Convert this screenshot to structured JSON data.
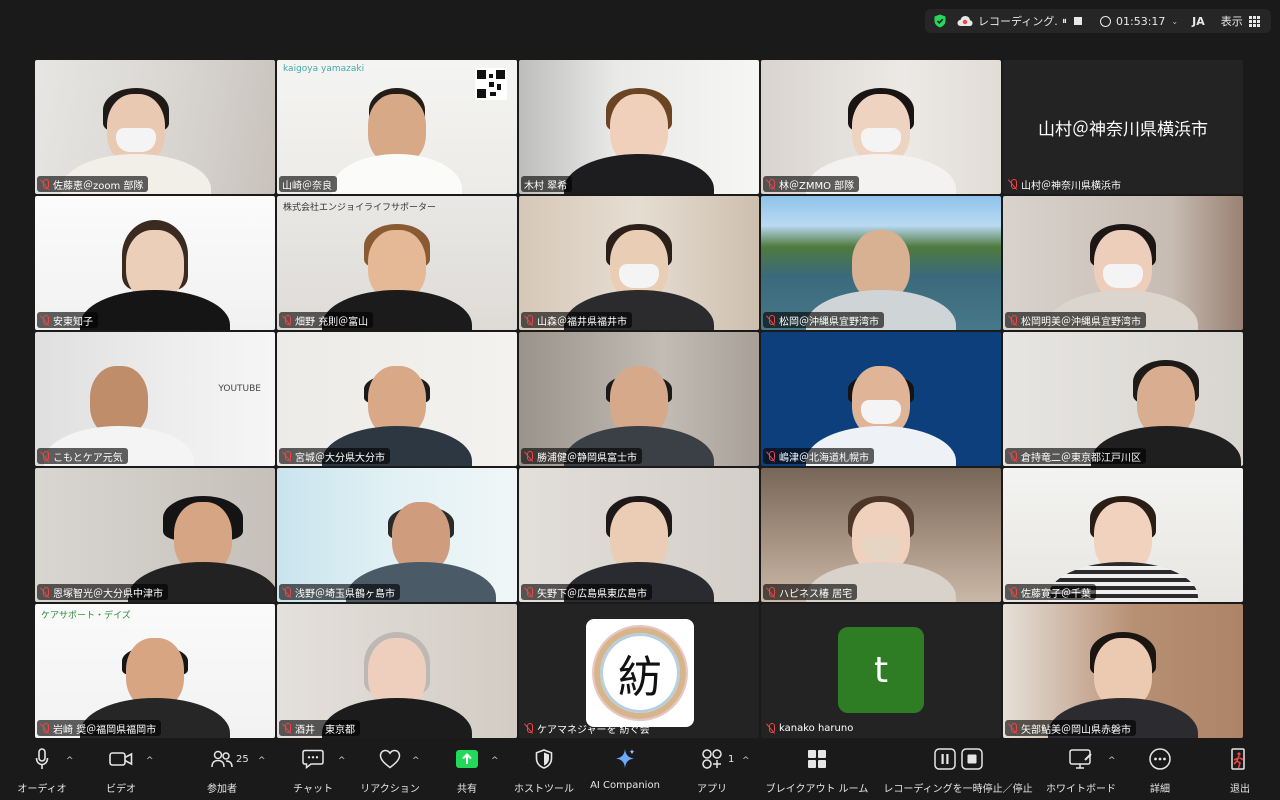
{
  "status_bar": {
    "recording_label": "レコーディング...",
    "pause_symbol": "⏸",
    "timer": "01:53:17",
    "chevron": "⌄",
    "language": "JA",
    "view_label": "表示"
  },
  "participants": [
    {
      "name": "佐藤恵＠zoom 部隊"
    },
    {
      "name": "山崎＠奈良",
      "banner": "kaigoya yamazaki"
    },
    {
      "name": "木村 翠希"
    },
    {
      "name": "林＠ZMMO 部隊"
    },
    {
      "name": "山村＠神奈川県横浜市",
      "display_text": "山村＠神奈川県横浜市"
    },
    {
      "name": "安東知子"
    },
    {
      "name": "畑野 充則＠富山",
      "banner": "株式会社エンジョイライフサポーター"
    },
    {
      "name": "山森＠福井県福井市"
    },
    {
      "name": "松岡＠沖縄県宜野湾市"
    },
    {
      "name": "松岡明美＠沖縄県宜野湾市"
    },
    {
      "name": "こもとケア元気",
      "banner": "YOUTUBE"
    },
    {
      "name": "宮城＠大分県大分市"
    },
    {
      "name": "勝浦健＠静岡県富士市"
    },
    {
      "name": "嶋津＠北海道札幌市"
    },
    {
      "name": "倉持竜二＠東京都江戸川区"
    },
    {
      "name": "恩塚智光＠大分県中津市"
    },
    {
      "name": "浅野＠埼玉県鶴ヶ島市"
    },
    {
      "name": "矢野下＠広島県東広島市"
    },
    {
      "name": "ハピネス椿 居宅"
    },
    {
      "name": "佐藤寛子＠千葉"
    },
    {
      "name": "岩崎 奨＠福岡県福岡市",
      "banner": "ケアサポート・デイズ"
    },
    {
      "name": "酒井　東京都"
    },
    {
      "name": "ケアマネジャーを 紡ぐ会",
      "logo_char": "紡"
    },
    {
      "name": "kanako haruno",
      "avatar_letter": "t"
    },
    {
      "name": "矢部鮎美＠岡山県赤磐市"
    }
  ],
  "toolbar": {
    "audio": "オーディオ",
    "video": "ビデオ",
    "participants": "参加者",
    "participants_count": "25",
    "chat": "チャット",
    "reactions": "リアクション",
    "share": "共有",
    "host_tools": "ホストツール",
    "ai_companion": "AI Companion",
    "apps": "アプリ",
    "apps_count": "1",
    "breakout": "ブレイクアウト ルーム",
    "recording": "レコーディングを一時停止／停止",
    "whiteboard": "ホワイトボード",
    "more": "詳細",
    "leave": "退出",
    "caret": "^"
  },
  "colors": {
    "active_speaker": "#23d959",
    "share_green": "#23d959",
    "muted_red": "#e44444",
    "avatar_green": "#2e7d24"
  }
}
